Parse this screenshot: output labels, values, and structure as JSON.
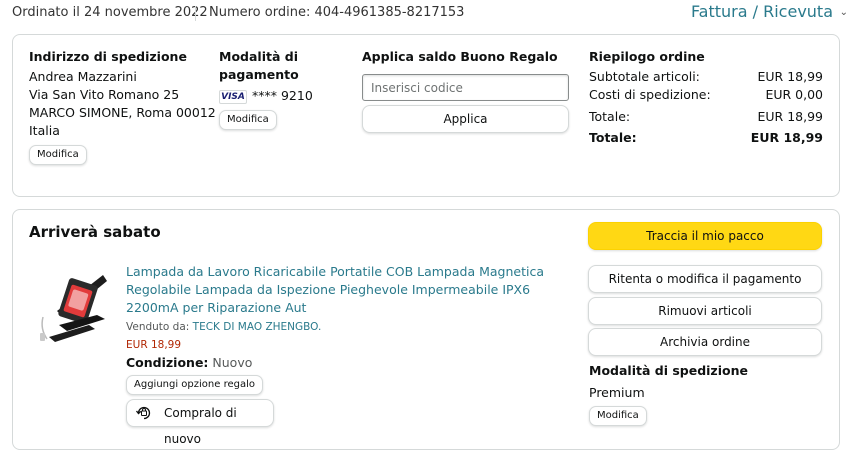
{
  "header": {
    "order_date": "Ordinato il 24 novembre 2022",
    "order_number": "Numero ordine: 404-4961385-8217153",
    "invoice_link": "Fattura / Ricevuta",
    "invoice_chevron": "⌄"
  },
  "shipping_address": {
    "heading": "Indirizzo di spedizione",
    "lines": [
      "Andrea Mazzarini",
      "Via San Vito Romano 25",
      "MARCO SIMONE, Roma 00012",
      "Italia"
    ],
    "edit_label": "Modifica"
  },
  "payment": {
    "heading_line1": "Modalità di",
    "heading_line2": "pagamento",
    "card_brand": "VISA",
    "card_masked": "**** 9210",
    "edit_label": "Modifica"
  },
  "gift_card": {
    "heading": "Applica saldo Buono Regalo",
    "placeholder": "Inserisci codice",
    "apply_label": "Applica"
  },
  "summary": {
    "heading": "Riepilogo ordine",
    "rows": [
      {
        "label": "Subtotale articoli:",
        "value": "EUR 18,99"
      },
      {
        "label": "Costi di spedizione:",
        "value": "EUR 0,00"
      },
      {
        "label": "Totale:",
        "value": "EUR 18,99"
      },
      {
        "label": "Totale:",
        "value": "EUR 18,99"
      }
    ]
  },
  "shipment": {
    "arrival": "Arriverà sabato",
    "product_title": "Lampada da Lavoro Ricaricabile Portatile COB Lampada Magnetica Regolabile Lampada da Ispezione Pieghevole Impermeabile IPX6 2200mA per Riparazione Aut",
    "sold_by_prefix": "Venduto da: ",
    "seller": "TECK DI MAO ZHENGBO.",
    "price": "EUR 18,99",
    "condition_label": "Condizione:",
    "condition_value": " Nuovo",
    "gift_option_label": "Aggiungi opzione regalo",
    "buy_again_label": "Compralo di nuovo",
    "track_label": "Traccia il mio pacco",
    "retry_payment_label": "Ritenta o modifica il pagamento",
    "remove_items_label": "Rimuovi articoli",
    "archive_label": "Archivia ordine",
    "shipping_method_heading": "Modalità di spedizione",
    "shipping_method_value": "Premium",
    "shipping_method_edit": "Modifica"
  },
  "colors": {
    "link": "#2a7a8c",
    "price": "#b12704",
    "primary_button": "#ffd814",
    "border": "#d5d9d9"
  }
}
